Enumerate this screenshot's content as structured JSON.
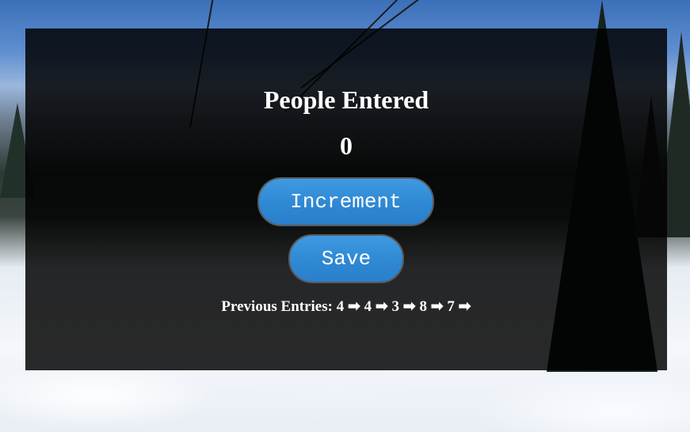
{
  "counter": {
    "title": "People Entered",
    "count": "0"
  },
  "buttons": {
    "increment_label": "Increment",
    "save_label": "Save"
  },
  "entries": {
    "label": "Previous Entries:",
    "values_text": "4 ➡ 4 ➡ 3 ➡ 8 ➡ 7 ➡",
    "values": [
      4,
      4,
      3,
      8,
      7
    ]
  },
  "colors": {
    "button_blue": "#2f88d3",
    "panel_overlay": "#000000",
    "text": "#ffffff"
  },
  "background": {
    "scene": "snowy-mountain-forest-photo"
  }
}
